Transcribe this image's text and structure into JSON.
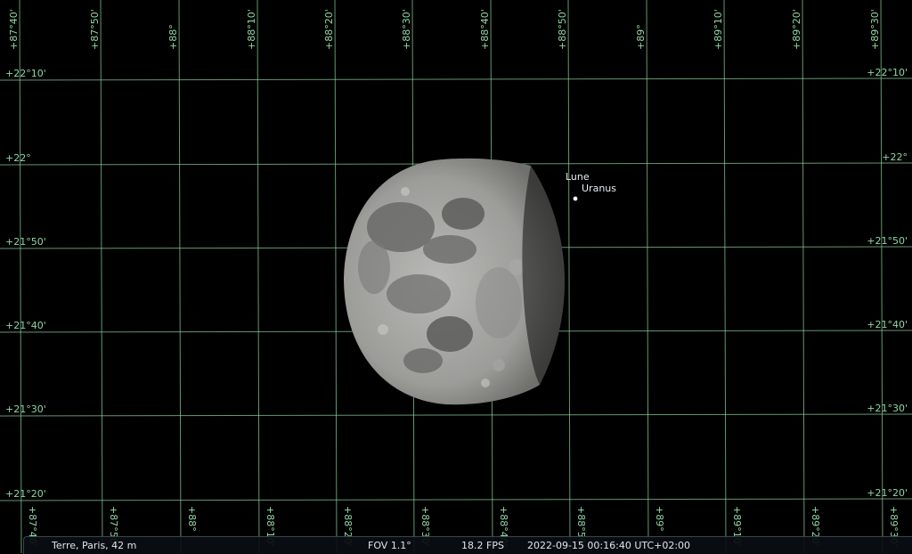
{
  "sky": {
    "background": "#000000",
    "grid_color": "#8fd6a4",
    "ra_labels": [
      "+87°40'",
      "+87°50'",
      "+88°",
      "+88°10'",
      "+88°20'",
      "+88°30'",
      "+88°40'",
      "+88°50'",
      "+89°",
      "+89°10'",
      "+89°20'",
      "+89°30'"
    ],
    "dec_labels": [
      "+22°10'",
      "+22°",
      "+21°50'",
      "+21°40'",
      "+21°30'",
      "+21°20'"
    ],
    "objects": {
      "moon_label": "Lune",
      "uranus_label": "Uranus"
    }
  },
  "status": {
    "location": "Terre, Paris, 42 m",
    "fov": "FOV 1.1°",
    "fps": "18.2 FPS",
    "datetime": "2022-09-15 00:16:40 UTC+02:00"
  }
}
